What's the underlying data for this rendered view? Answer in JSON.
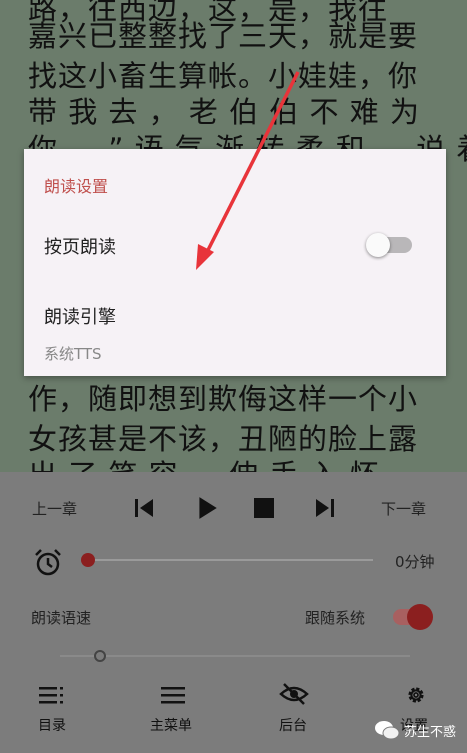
{
  "reader": {
    "lines": [
      "路，往西边，这，是，我往",
      "嘉兴已整整找了三天，就是要",
      "找这小畜生算帐。小娃娃，你",
      "带 我 去 ， 老 伯 伯 不 难 为",
      "你 。 ” 语 气 渐 转 柔 和 ， 说 着 放",
      "作，随即想到欺侮这样一个小",
      "女孩甚是不该，丑陋的脸上露",
      "出 了 笑 容 ， 伸 手 入 怀"
    ]
  },
  "dialog": {
    "title": "朗读设置",
    "page_read_label": "按页朗读",
    "page_read_on": false,
    "engine_label": "朗读引擎",
    "engine_value": "系统TTS"
  },
  "controls": {
    "prev_chapter": "上一章",
    "next_chapter": "下一章",
    "timer_value": "0分钟",
    "speed_label": "朗读语速",
    "follow_system_label": "跟随系统",
    "follow_system_on": true
  },
  "nav": {
    "items": [
      {
        "label": "目录",
        "icon": "toc-icon"
      },
      {
        "label": "主菜单",
        "icon": "menu-icon"
      },
      {
        "label": "后台",
        "icon": "eye-off-icon"
      },
      {
        "label": "设置",
        "icon": "gear-icon"
      }
    ]
  },
  "watermark": {
    "text": "苏生不惑"
  },
  "colors": {
    "accent": "#c0504d",
    "panel": "#7c7c7c",
    "reader_bg": "#6b7c6b"
  }
}
